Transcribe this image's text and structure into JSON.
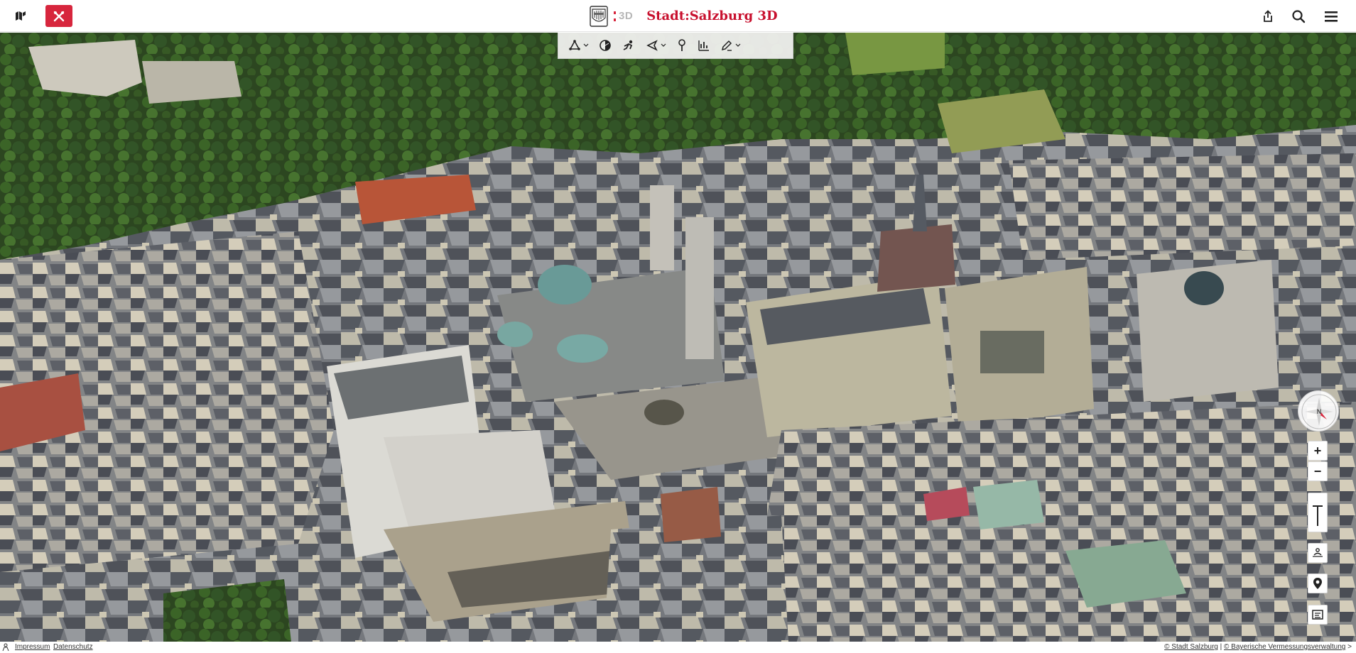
{
  "header": {
    "logo_3d_text": "3D",
    "title": "Stadt:Salzburg 3D",
    "icons": {
      "layers": "layers-icon",
      "tools": "tools-icon",
      "share": "share-icon",
      "search": "search-icon",
      "menu": "menu-icon"
    }
  },
  "toolbar": {
    "tools": [
      "measure-icon",
      "shadow-icon",
      "walk-mode-icon",
      "flight-icon",
      "pin-icon",
      "height-profile-icon",
      "draw-icon"
    ]
  },
  "controls": {
    "compass_label": "N",
    "zoom_in": "+",
    "zoom_out": "−"
  },
  "footer": {
    "impressum": "Impressum",
    "datenschutz": "Datenschutz",
    "credit_1": "© Stadt Salzburg",
    "separator": " | ",
    "credit_2": "© Bayerische Vermessungsverwaltung",
    "more": " >"
  },
  "colors": {
    "brand_red": "#c8102e",
    "tools_button_bg": "#d7263d"
  }
}
